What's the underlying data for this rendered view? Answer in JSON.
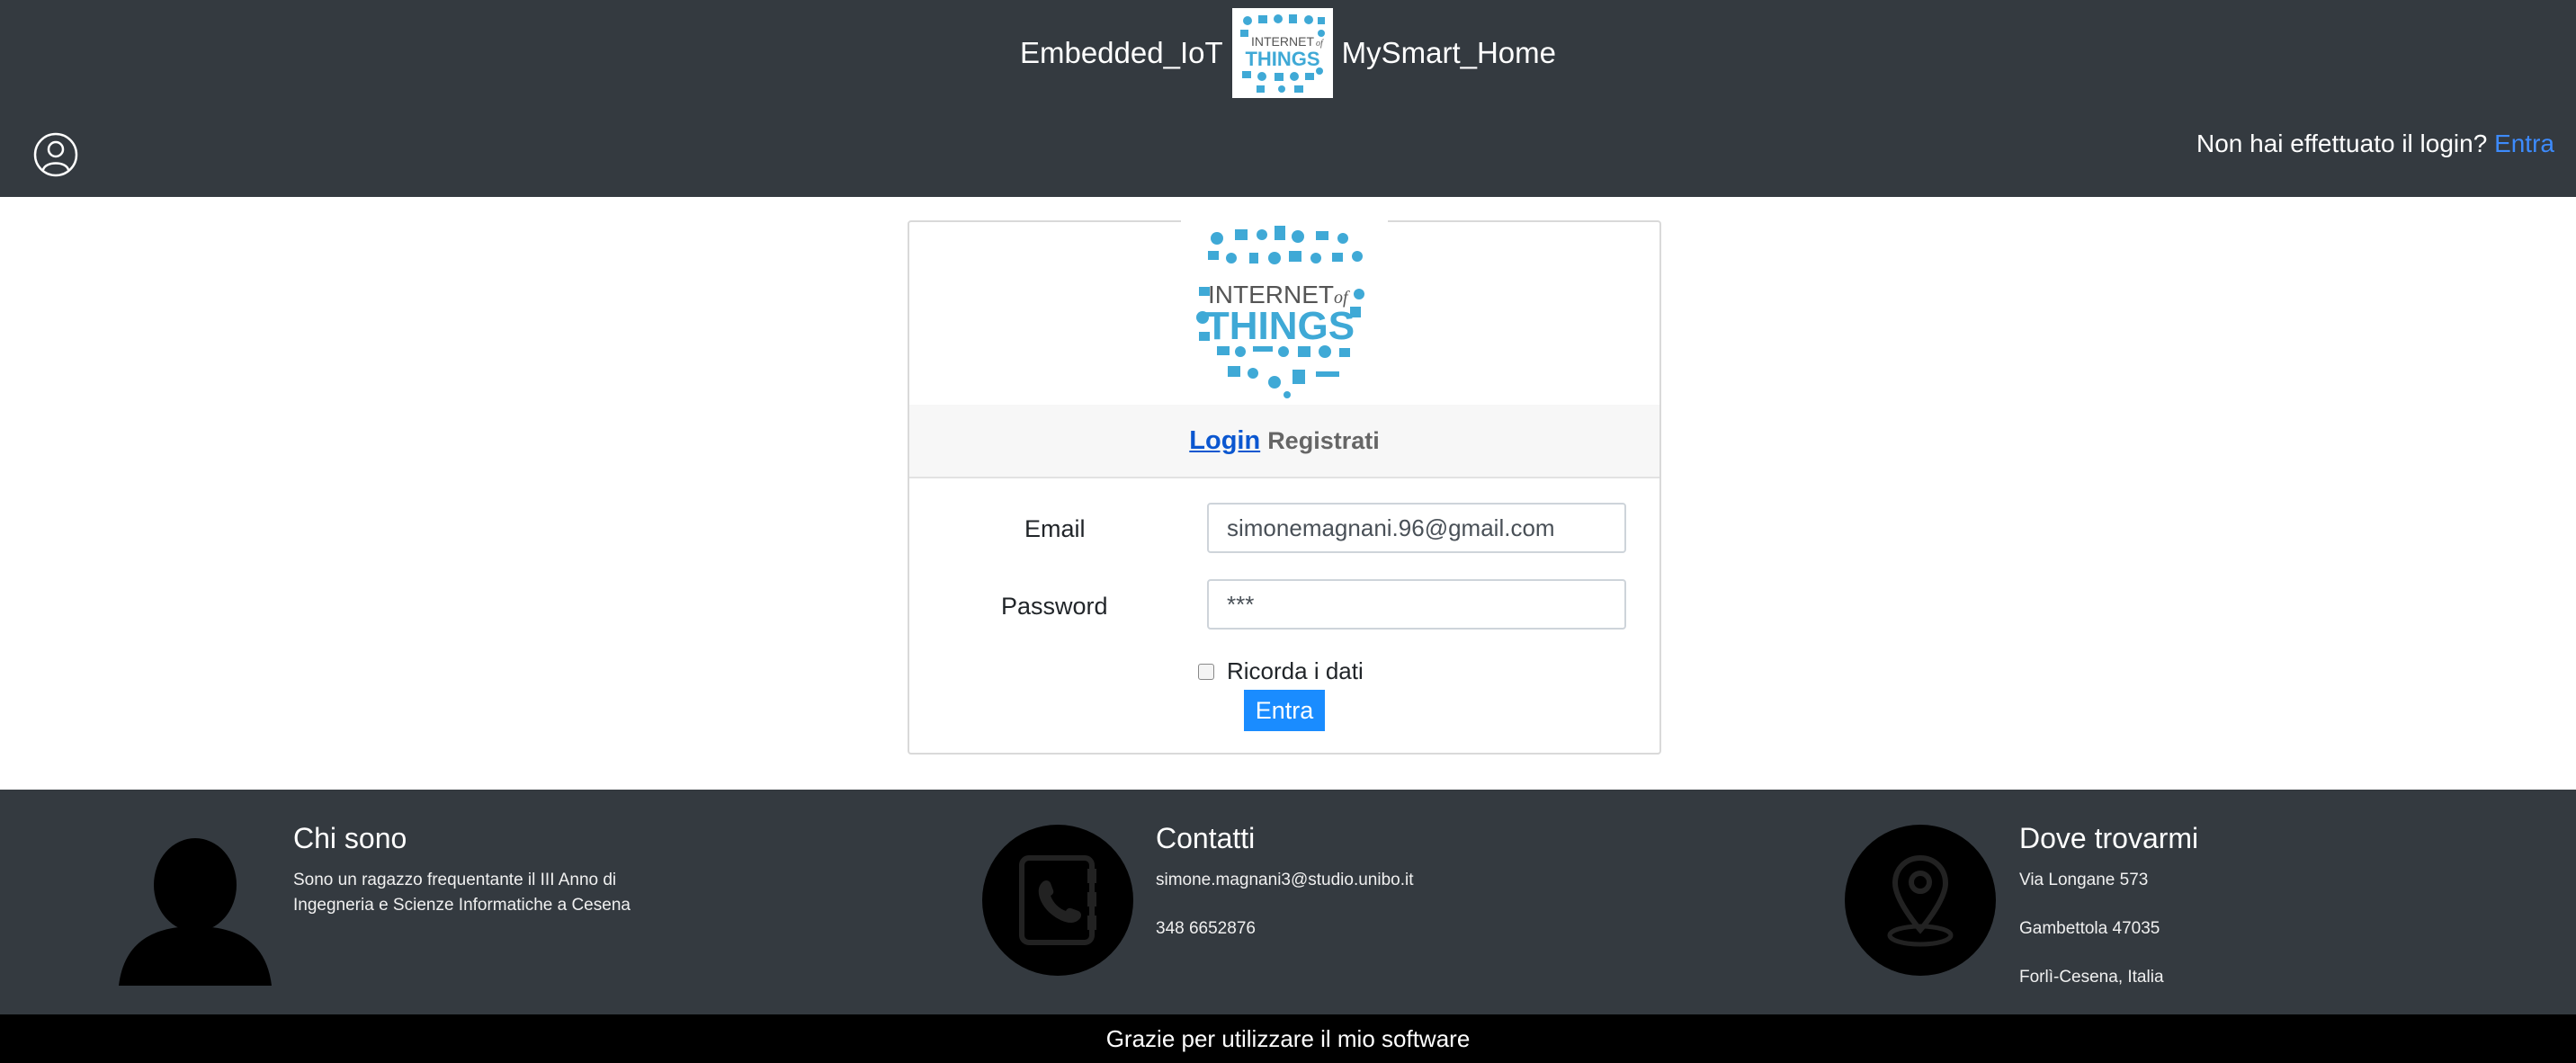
{
  "header": {
    "brand_left": "Embedded_IoT",
    "brand_right": "MySmart_Home",
    "logo": {
      "line1": "INTERNET",
      "line1b": "of",
      "line2": "THINGS"
    },
    "login_prompt": "Non hai effettuato il login?",
    "login_link": "Entra"
  },
  "card": {
    "logo": {
      "line1": "INTERNET",
      "line1b": "of",
      "line2": "THINGS"
    },
    "tabs": {
      "login": "Login",
      "register": "Registrati"
    },
    "email_label": "Email",
    "email_value": "simonemagnani.96@gmail.com",
    "password_label": "Password",
    "password_value": "***",
    "remember_label": "Ricorda i dati",
    "submit_label": "Entra"
  },
  "footer": {
    "about": {
      "title": "Chi sono",
      "line1": "Sono un ragazzo frequentante il III Anno di",
      "line2": "Ingegneria e Scienze Informatiche a Cesena"
    },
    "contacts": {
      "title": "Contatti",
      "email": "simone.magnani3@studio.unibo.it",
      "phone": "348 6652876"
    },
    "location": {
      "title": "Dove trovarmi",
      "address": "Via Longane 573",
      "city": "Gambettola 47035",
      "region": "Forlì-Cesena, Italia"
    },
    "bottom_text": "Grazie per utilizzare il mio software"
  },
  "colors": {
    "navbar": "#343a40",
    "accent": "#1a8cff",
    "link": "#3d8bfd",
    "logo_blue": "#3fa9d6"
  },
  "icons": [
    "user-outline-icon",
    "person-silhouette-icon",
    "contact-book-icon",
    "map-pin-icon"
  ]
}
